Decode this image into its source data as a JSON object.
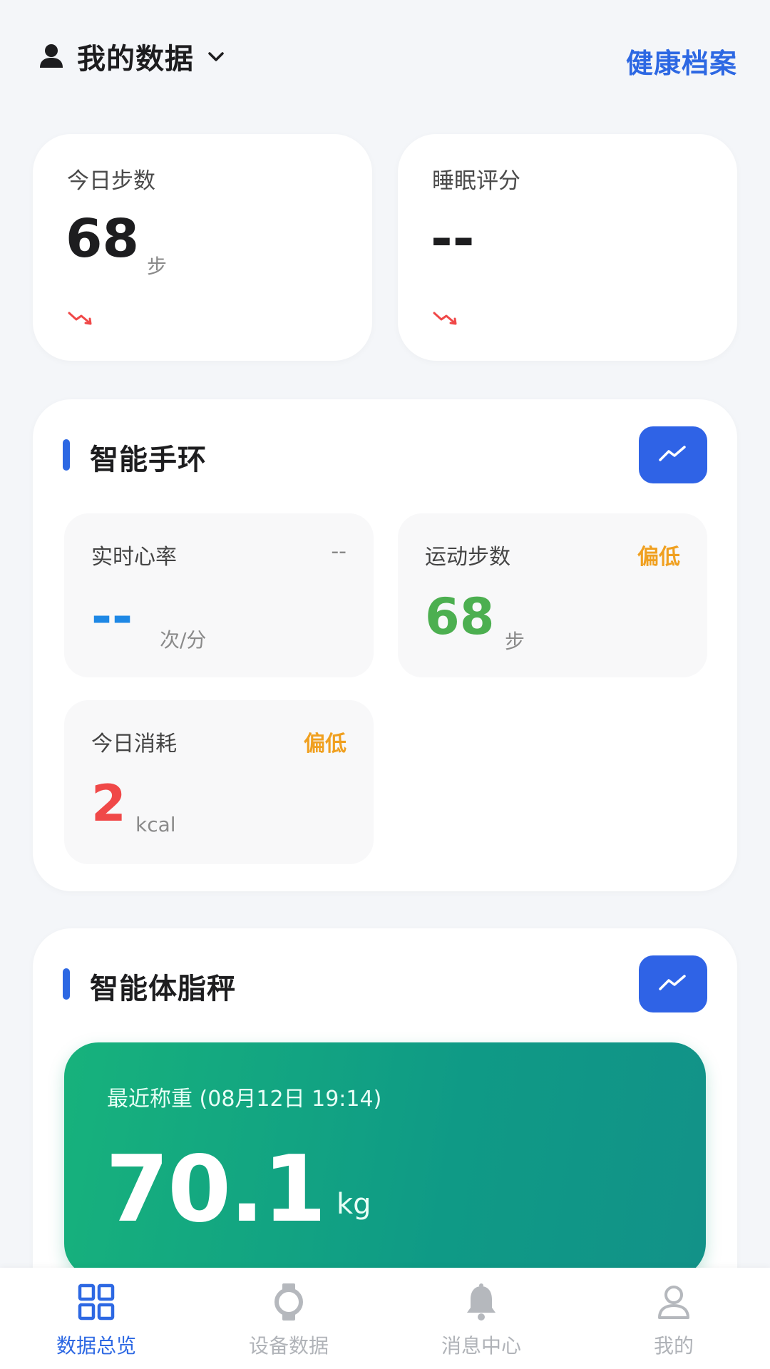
{
  "header": {
    "title": "我的数据",
    "right_link": "健康档案",
    "icons": {
      "user": "user-icon",
      "dropdown": "chevron-down-icon"
    }
  },
  "summary": {
    "steps": {
      "label": "今日步数",
      "value": "68",
      "unit": "步"
    },
    "sleep": {
      "label": "睡眠评分",
      "value": "--"
    }
  },
  "band": {
    "title": "智能手环",
    "heart": {
      "label": "实时心率",
      "status": "--",
      "value": "--",
      "unit": "次/分"
    },
    "steps": {
      "label": "运动步数",
      "status": "偏低",
      "value": "68",
      "unit": "步"
    },
    "calories": {
      "label": "今日消耗",
      "status": "偏低",
      "value": "2",
      "unit": "kcal"
    }
  },
  "scale": {
    "title": "智能体脂秤",
    "recent_label": "最近称重 (08月12日 19:14)",
    "weight": "70.1",
    "unit": "kg"
  },
  "nav": [
    {
      "label": "数据总览",
      "icon": "grid-icon",
      "active": true
    },
    {
      "label": "设备数据",
      "icon": "watch-icon",
      "active": false
    },
    {
      "label": "消息中心",
      "icon": "bell-icon",
      "active": false
    },
    {
      "label": "我的",
      "icon": "profile-icon",
      "active": false
    }
  ],
  "colors": {
    "accent": "#2d68e3",
    "warning": "#f0a020",
    "green": "#4caf50",
    "red": "#f04848",
    "heart_blue": "#1e88e5",
    "weight_gradient_start": "#17b27c",
    "weight_gradient_end": "#129288"
  }
}
